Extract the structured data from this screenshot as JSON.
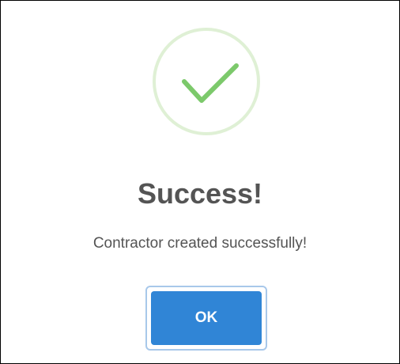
{
  "dialog": {
    "title": "Success!",
    "message": "Contractor created successfully!",
    "icon": "success-check-icon",
    "ok_label": "OK"
  },
  "colors": {
    "check": "#7cc96b",
    "ring": "#dff0d5",
    "button": "#3085d6",
    "button_focus_ring": "#a8c8ea",
    "text": "#545454"
  }
}
